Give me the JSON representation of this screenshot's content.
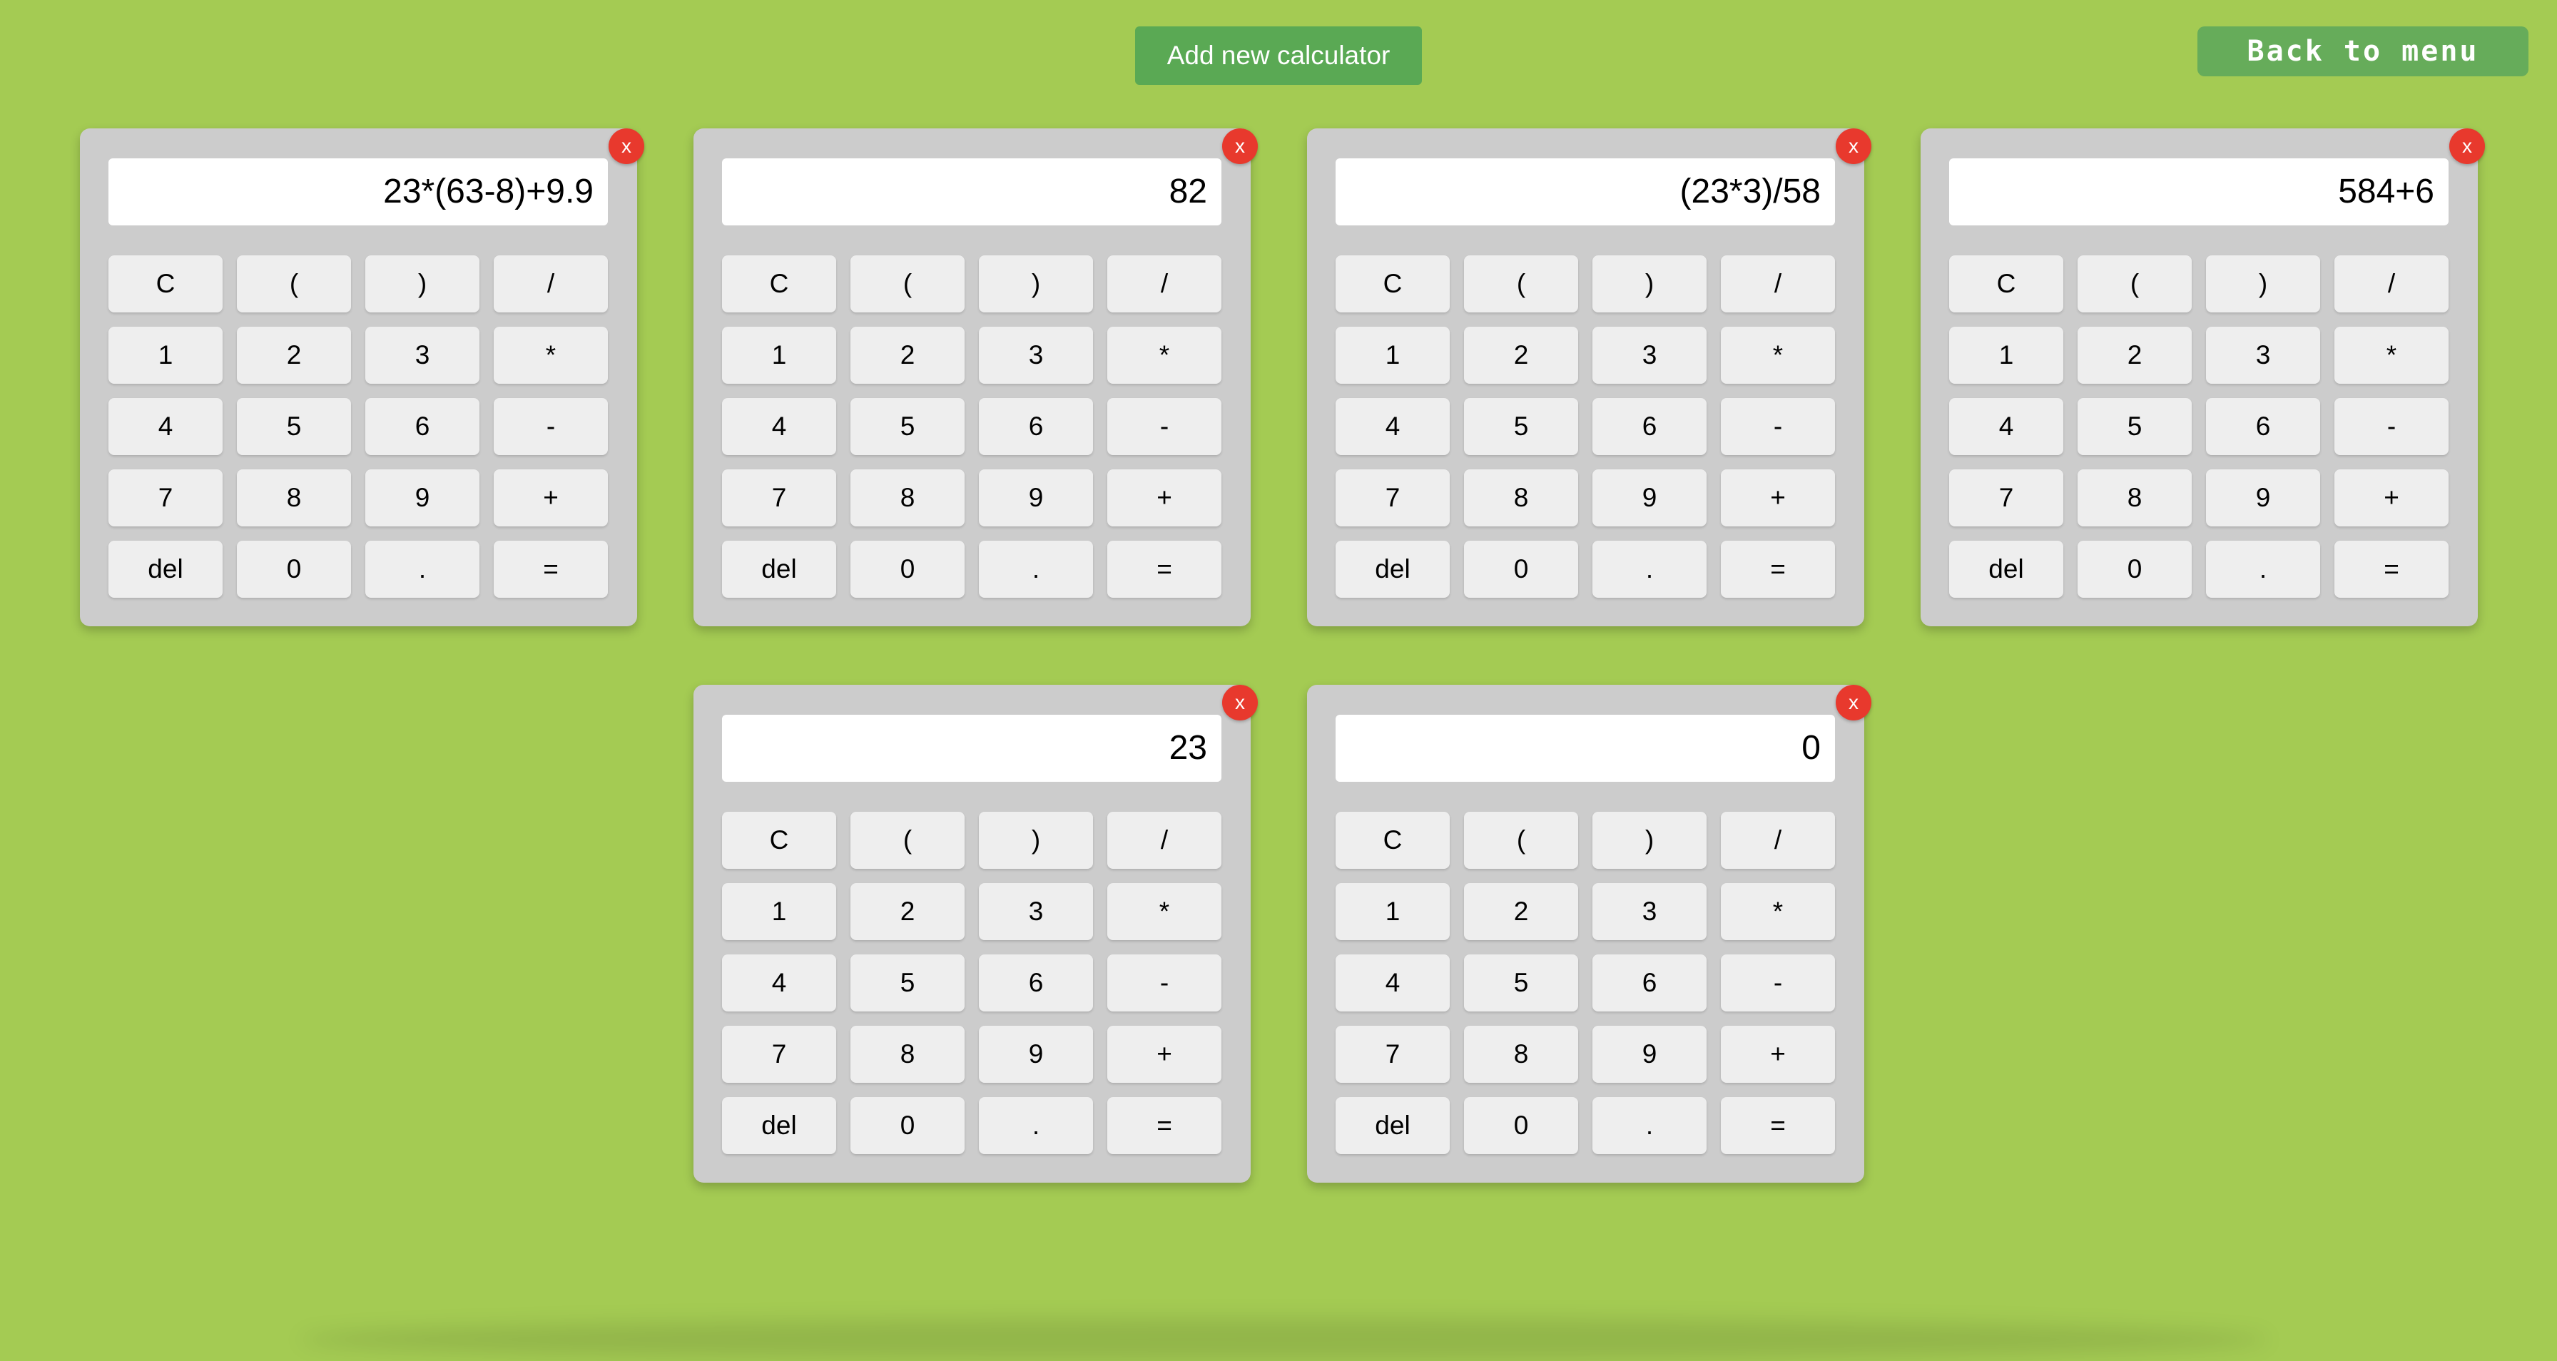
{
  "header": {
    "add_label": "Add new calculator",
    "back_label": "Back to menu"
  },
  "calculators": [
    {
      "display": "23*(63-8)+9.9",
      "close_label": "x"
    },
    {
      "display": "82",
      "close_label": "x"
    },
    {
      "display": "(23*3)/58",
      "close_label": "x"
    },
    {
      "display": "584+6",
      "close_label": "x"
    },
    {
      "display": "23",
      "close_label": "x"
    },
    {
      "display": "0",
      "close_label": "x"
    }
  ],
  "keys": [
    "C",
    "(",
    ")",
    "/",
    "1",
    "2",
    "3",
    "*",
    "4",
    "5",
    "6",
    "-",
    "7",
    "8",
    "9",
    "+",
    "del",
    "0",
    ".",
    "="
  ],
  "colors": {
    "background": "#a4cb53",
    "add_button": "#5aa954",
    "back_button": "#66ac5a",
    "calculator_body": "#cccccc",
    "key": "#eeeeee",
    "close_button": "#e8392d"
  }
}
